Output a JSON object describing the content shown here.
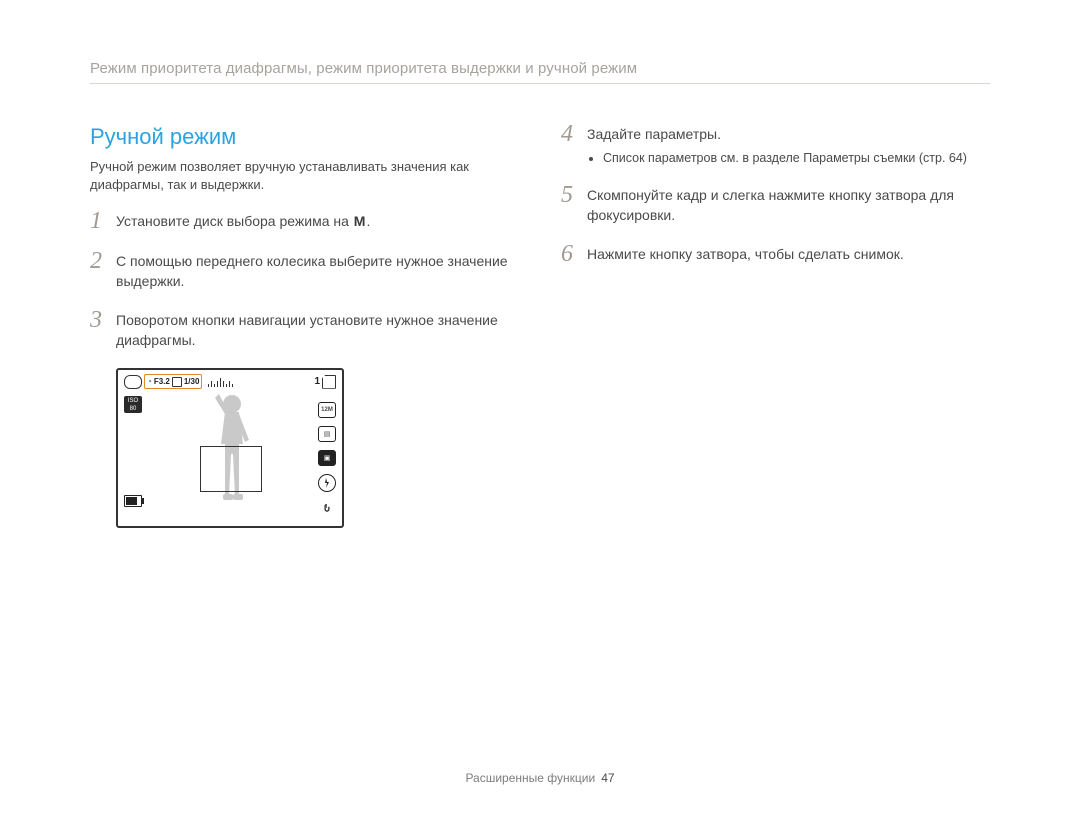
{
  "header": {
    "breadcrumb": "Режим приоритета диафрагмы, режим приоритета выдержки и ручной режим"
  },
  "section": {
    "title": "Ручной режим",
    "intro": "Ручной режим позволяет вручную устанавливать значения как диафрагмы, так и выдержки."
  },
  "steps": [
    {
      "num": "1",
      "text_pre": "Установите диск выбора режима на ",
      "text_post": ".",
      "mode_label": "M"
    },
    {
      "num": "2",
      "text": "С помощью переднего колесика выберите нужное значение выдержки."
    },
    {
      "num": "3",
      "text": "Поворотом кнопки навигации установите нужное значение диафрагмы."
    },
    {
      "num": "4",
      "text": "Задайте параметры.",
      "sub": [
        "Список параметров см. в разделе Параметры съемки (стр. 64)"
      ]
    },
    {
      "num": "5",
      "text": "Скомпонуйте кадр и слегка нажмите кнопку затвора для фокусировки."
    },
    {
      "num": "6",
      "text": "Нажмите кнопку затвора, чтобы сделать снимок."
    }
  ],
  "camera_screen": {
    "aperture_label": "F3.2",
    "shutter_label": "1/30",
    "counter": "1",
    "iso_label_top": "ISO",
    "iso_label_bottom": "80",
    "right_icons": [
      "resolution-icon",
      "quality-icon",
      "metering-icon",
      "flash-off-icon",
      "stabilizer-icon"
    ]
  },
  "footer": {
    "section": "Расширенные функции",
    "page": "47"
  }
}
